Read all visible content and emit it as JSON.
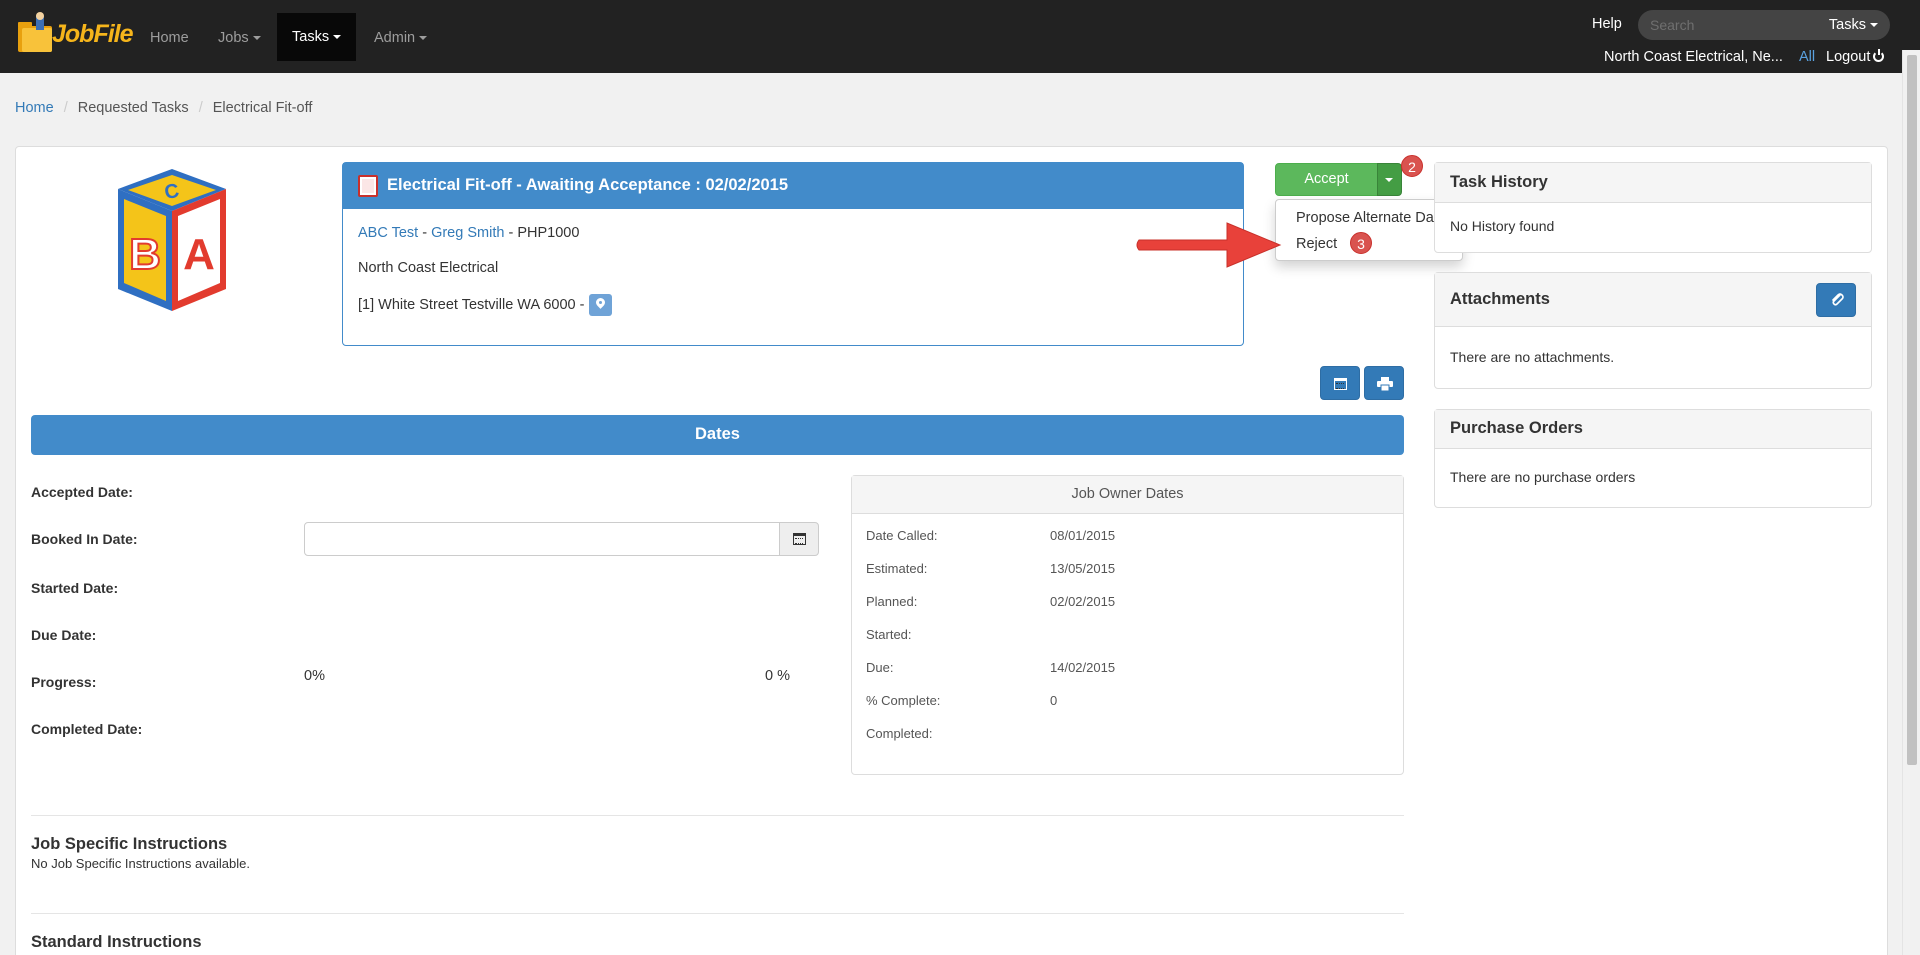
{
  "app": {
    "logo_text": "JobFile"
  },
  "nav": {
    "items": [
      {
        "label": "Home"
      },
      {
        "label": "Jobs"
      },
      {
        "label": "Tasks"
      },
      {
        "label": "Admin"
      }
    ],
    "help_label": "Help",
    "search_placeholder": "Search",
    "search_scope": "Tasks",
    "company": "North Coast Electrical, Ne...",
    "all_label": "All",
    "logout_label": "Logout"
  },
  "breadcrumb": [
    "Home",
    "Requested Tasks",
    "Electrical Fit-off"
  ],
  "task": {
    "header": "Electrical Fit-off - Awaiting Acceptance : 02/02/2015",
    "client_link": "ABC Test",
    "contact_link": "Greg Smith",
    "job_code": "PHP1000",
    "company": "North Coast Electrical",
    "address": "[1] White Street Testville WA 6000 -"
  },
  "actions": {
    "accept_label": "Accept",
    "badge_2": "2",
    "badge_3": "3",
    "dropdown": [
      "Propose Alternate Date",
      "Reject"
    ]
  },
  "dates": {
    "title": "Dates",
    "labels": {
      "accepted": "Accepted Date:",
      "booked": "Booked In Date:",
      "started": "Started Date:",
      "due": "Due Date:",
      "progress": "Progress:",
      "completed": "Completed Date:"
    },
    "progress_left": "0%",
    "progress_right": "0 %"
  },
  "owner_dates": {
    "title": "Job Owner Dates",
    "rows": [
      {
        "label": "Date Called:",
        "value": "08/01/2015"
      },
      {
        "label": "Estimated:",
        "value": "13/05/2015"
      },
      {
        "label": "Planned:",
        "value": "02/02/2015"
      },
      {
        "label": "Started:",
        "value": ""
      },
      {
        "label": "Due:",
        "value": "14/02/2015"
      },
      {
        "label": "% Complete:",
        "value": "0"
      },
      {
        "label": "Completed:",
        "value": ""
      }
    ]
  },
  "instructions": {
    "job_title": "Job Specific Instructions",
    "job_text": "No Job Specific Instructions available.",
    "standard_title": "Standard Instructions"
  },
  "side": {
    "history_title": "Task History",
    "history_text": "No History found",
    "attachments_title": "Attachments",
    "attachments_text": "There are no attachments.",
    "orders_title": "Purchase Orders",
    "orders_text": "There are no purchase orders"
  },
  "colors": {
    "navbar": "#222222",
    "primary": "#428bca",
    "success": "#5cb85c",
    "danger": "#d9534f",
    "arrow": "#e8413a"
  }
}
